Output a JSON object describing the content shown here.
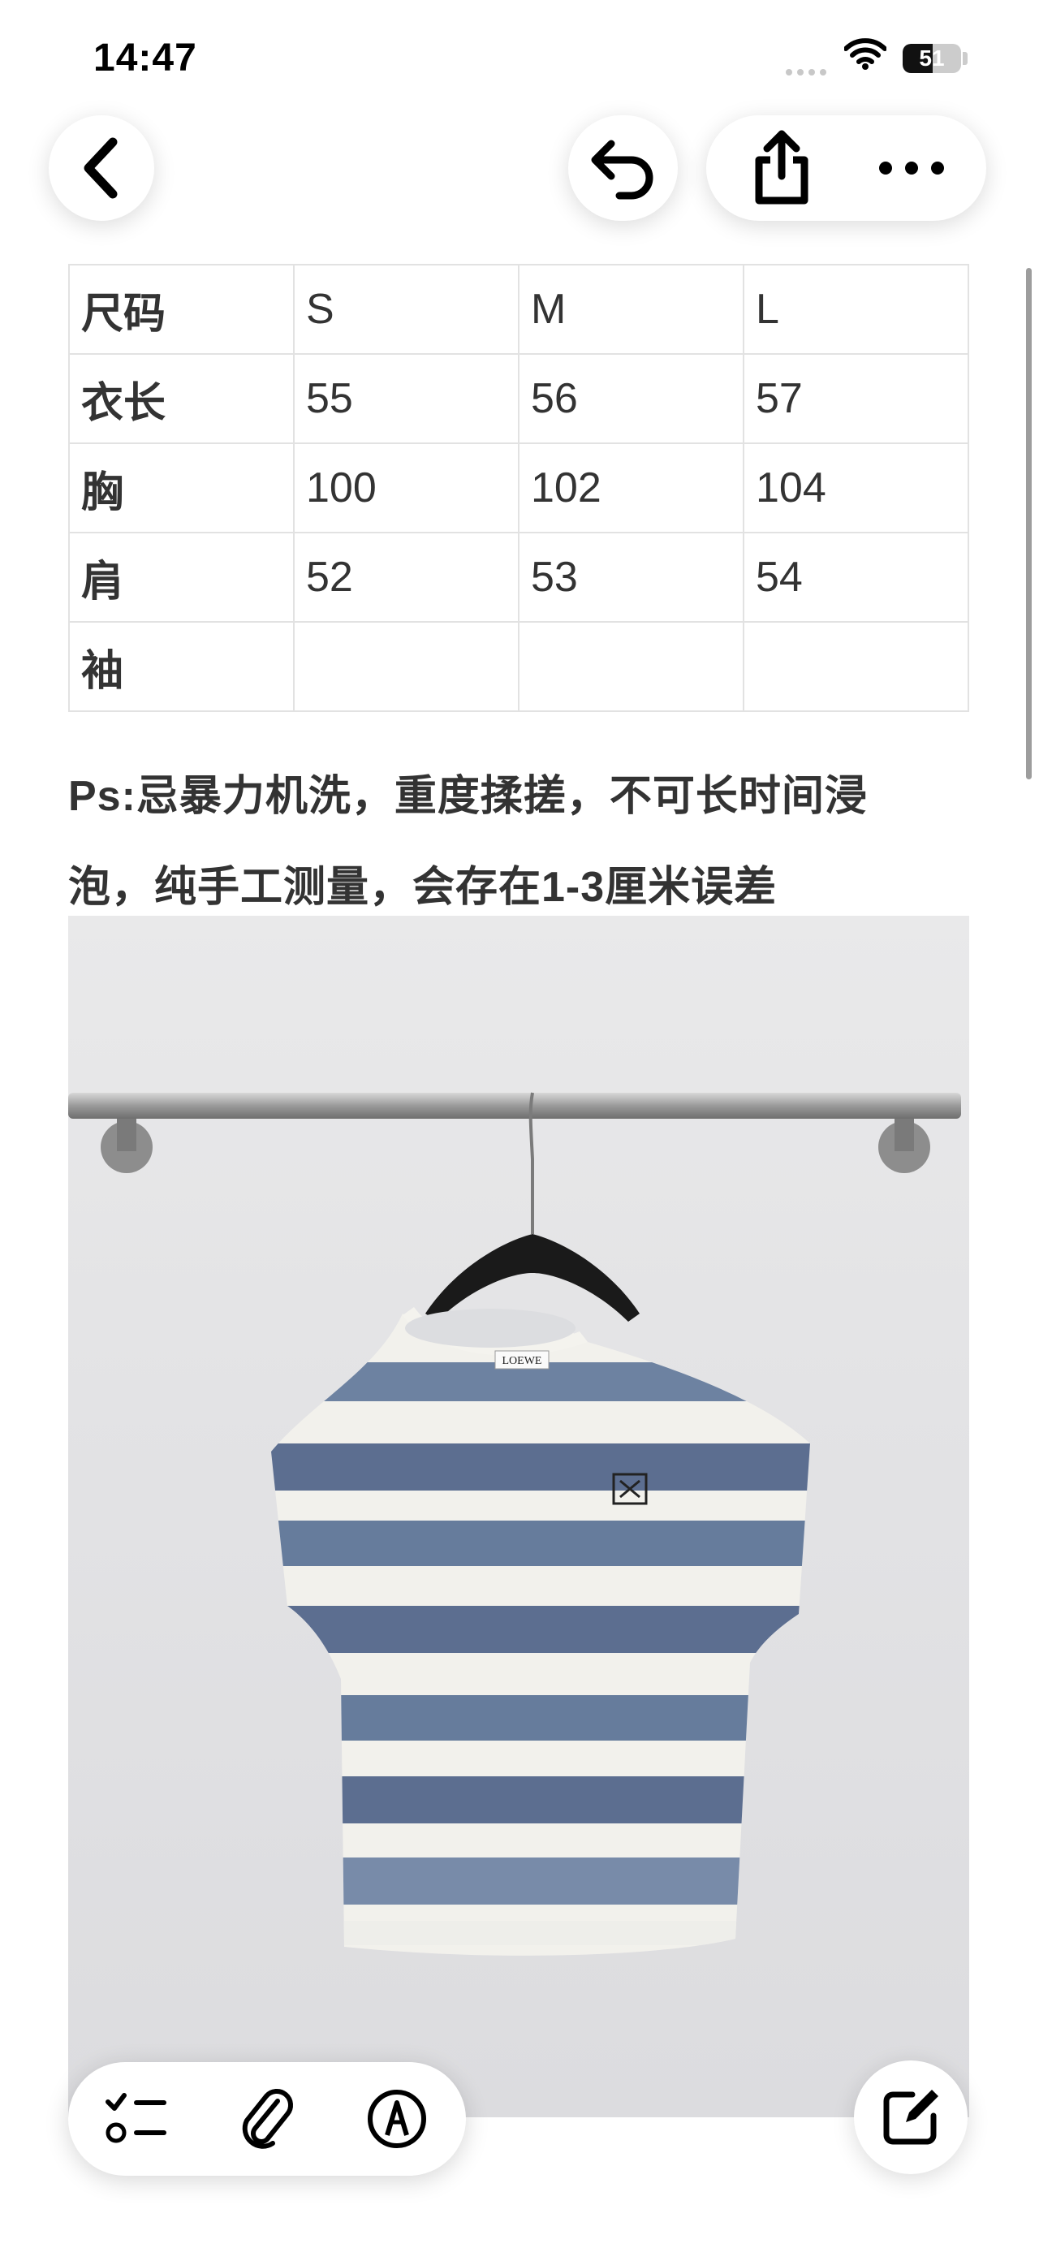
{
  "status_bar": {
    "time": "14:47",
    "battery": "51",
    "battery_level": 0.51
  },
  "nav": {
    "back_icon": "chevron-left-icon",
    "undo_icon": "undo-icon",
    "share_icon": "share-icon",
    "more_icon": "more-icon"
  },
  "size_table": {
    "rows": [
      [
        "尺码",
        "S",
        "M",
        "L"
      ],
      [
        "衣长",
        "55",
        "56",
        "57"
      ],
      [
        "胸",
        "100",
        "102",
        "104"
      ],
      [
        "肩",
        "52",
        "53",
        "54"
      ],
      [
        "袖",
        "",
        "",
        ""
      ]
    ]
  },
  "note": {
    "line1": "Ps:忌暴力机洗，重度揉搓，不可长时间浸",
    "line2": "泡，纯手工测量，会存在1-3厘米误差"
  },
  "photo": {
    "neck_label": "LOEWE",
    "stripe_colors": [
      "#566f94",
      "#4b5f86",
      "#6a7fa2"
    ]
  },
  "toolbar": {
    "checklist_icon": "checklist-icon",
    "attachment_icon": "paperclip-icon",
    "markup_icon": "markup-pen-icon",
    "compose_icon": "compose-icon"
  }
}
